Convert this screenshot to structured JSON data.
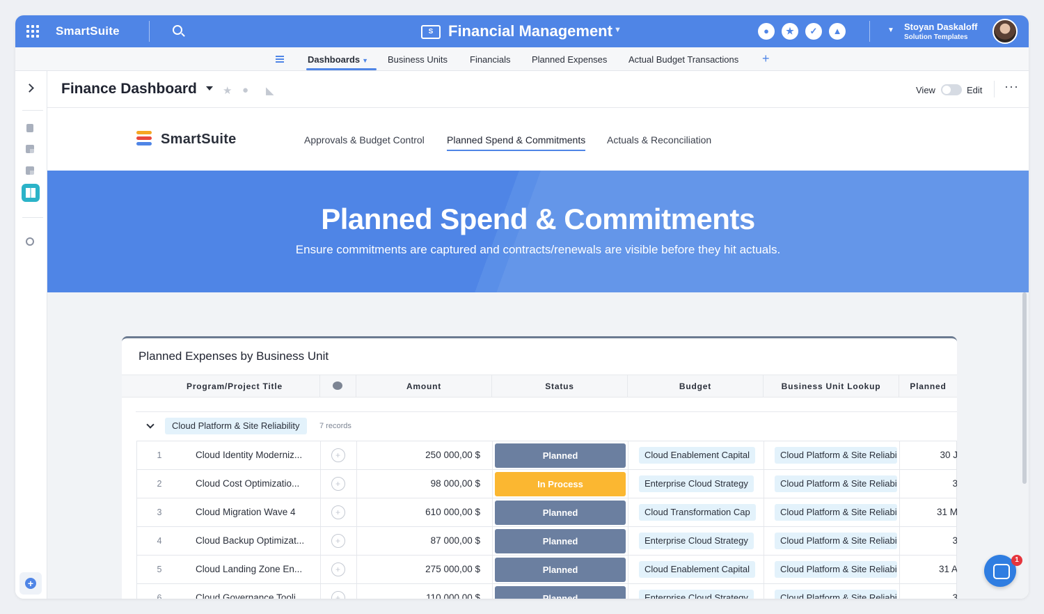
{
  "topbar": {
    "brand": "SmartSuite",
    "workspace_logo": "S",
    "workspace_title": "Financial Management",
    "icons": [
      "team-icon",
      "star-icon",
      "check-icon",
      "bell-icon"
    ],
    "user_name": "Stoyan Daskaloff",
    "user_role": "Solution Templates",
    "accent_color": "#4f85e6"
  },
  "nav": {
    "tabs": [
      "Dashboards",
      "Business Units",
      "Financials",
      "Planned Expenses",
      "Actual Budget Transactions"
    ],
    "active_tab": "Dashboards"
  },
  "dashboard": {
    "title": "Finance Dashboard",
    "view_label": "View",
    "edit_label": "Edit",
    "more": "···"
  },
  "canvas": {
    "logo_text": "SmartSuite",
    "sub_tabs": [
      "Approvals & Budget Control",
      "Planned Spend & Commitments",
      "Actuals & Reconciliation"
    ],
    "active_sub_tab": "Planned Spend & Commitments",
    "hero_title": "Planned Spend & Commitments",
    "hero_subtitle": "Ensure commitments are captured and contracts/renewals are visible before they hit actuals."
  },
  "widget": {
    "title": "Planned Expenses by Business Unit",
    "columns": [
      "Program/Project Title",
      "",
      "Amount",
      "Status",
      "Budget",
      "Business Unit Lookup",
      "Planned"
    ],
    "group": {
      "label": "Cloud Platform & Site Reliability",
      "count": "7 records"
    },
    "rows": [
      {
        "num": "1",
        "title": "Cloud Identity Moderniz...",
        "amount": "250 000,00 $",
        "status": "Planned",
        "status_color": "#6b7fa0",
        "budget": "Cloud Enablement Capital",
        "bu": "Cloud Platform & Site Reliabi",
        "planned": "30 J"
      },
      {
        "num": "2",
        "title": "Cloud Cost Optimizatio...",
        "amount": "98 000,00 $",
        "status": "In Process",
        "status_color": "#fbb731",
        "budget": "Enterprise Cloud Strategy",
        "bu": "Cloud Platform & Site Reliabi",
        "planned": "3"
      },
      {
        "num": "3",
        "title": "Cloud Migration Wave 4",
        "amount": "610 000,00 $",
        "status": "Planned",
        "status_color": "#6b7fa0",
        "budget": "Cloud Transformation Cap",
        "bu": "Cloud Platform & Site Reliabi",
        "planned": "31 M"
      },
      {
        "num": "4",
        "title": "Cloud Backup Optimizat...",
        "amount": "87 000,00 $",
        "status": "Planned",
        "status_color": "#6b7fa0",
        "budget": "Enterprise Cloud Strategy",
        "bu": "Cloud Platform & Site Reliabi",
        "planned": "3"
      },
      {
        "num": "5",
        "title": "Cloud Landing Zone En...",
        "amount": "275 000,00 $",
        "status": "Planned",
        "status_color": "#6b7fa0",
        "budget": "Cloud Enablement Capital",
        "bu": "Cloud Platform & Site Reliabi",
        "planned": "31 A"
      },
      {
        "num": "6",
        "title": "Cloud Governance Tooli...",
        "amount": "110 000,00 $",
        "status": "Planned",
        "status_color": "#6b7fa0",
        "budget": "Enterprise Cloud Strategy",
        "bu": "Cloud Platform & Site Reliabi",
        "planned": "3"
      }
    ]
  },
  "chat": {
    "badge": "1"
  }
}
